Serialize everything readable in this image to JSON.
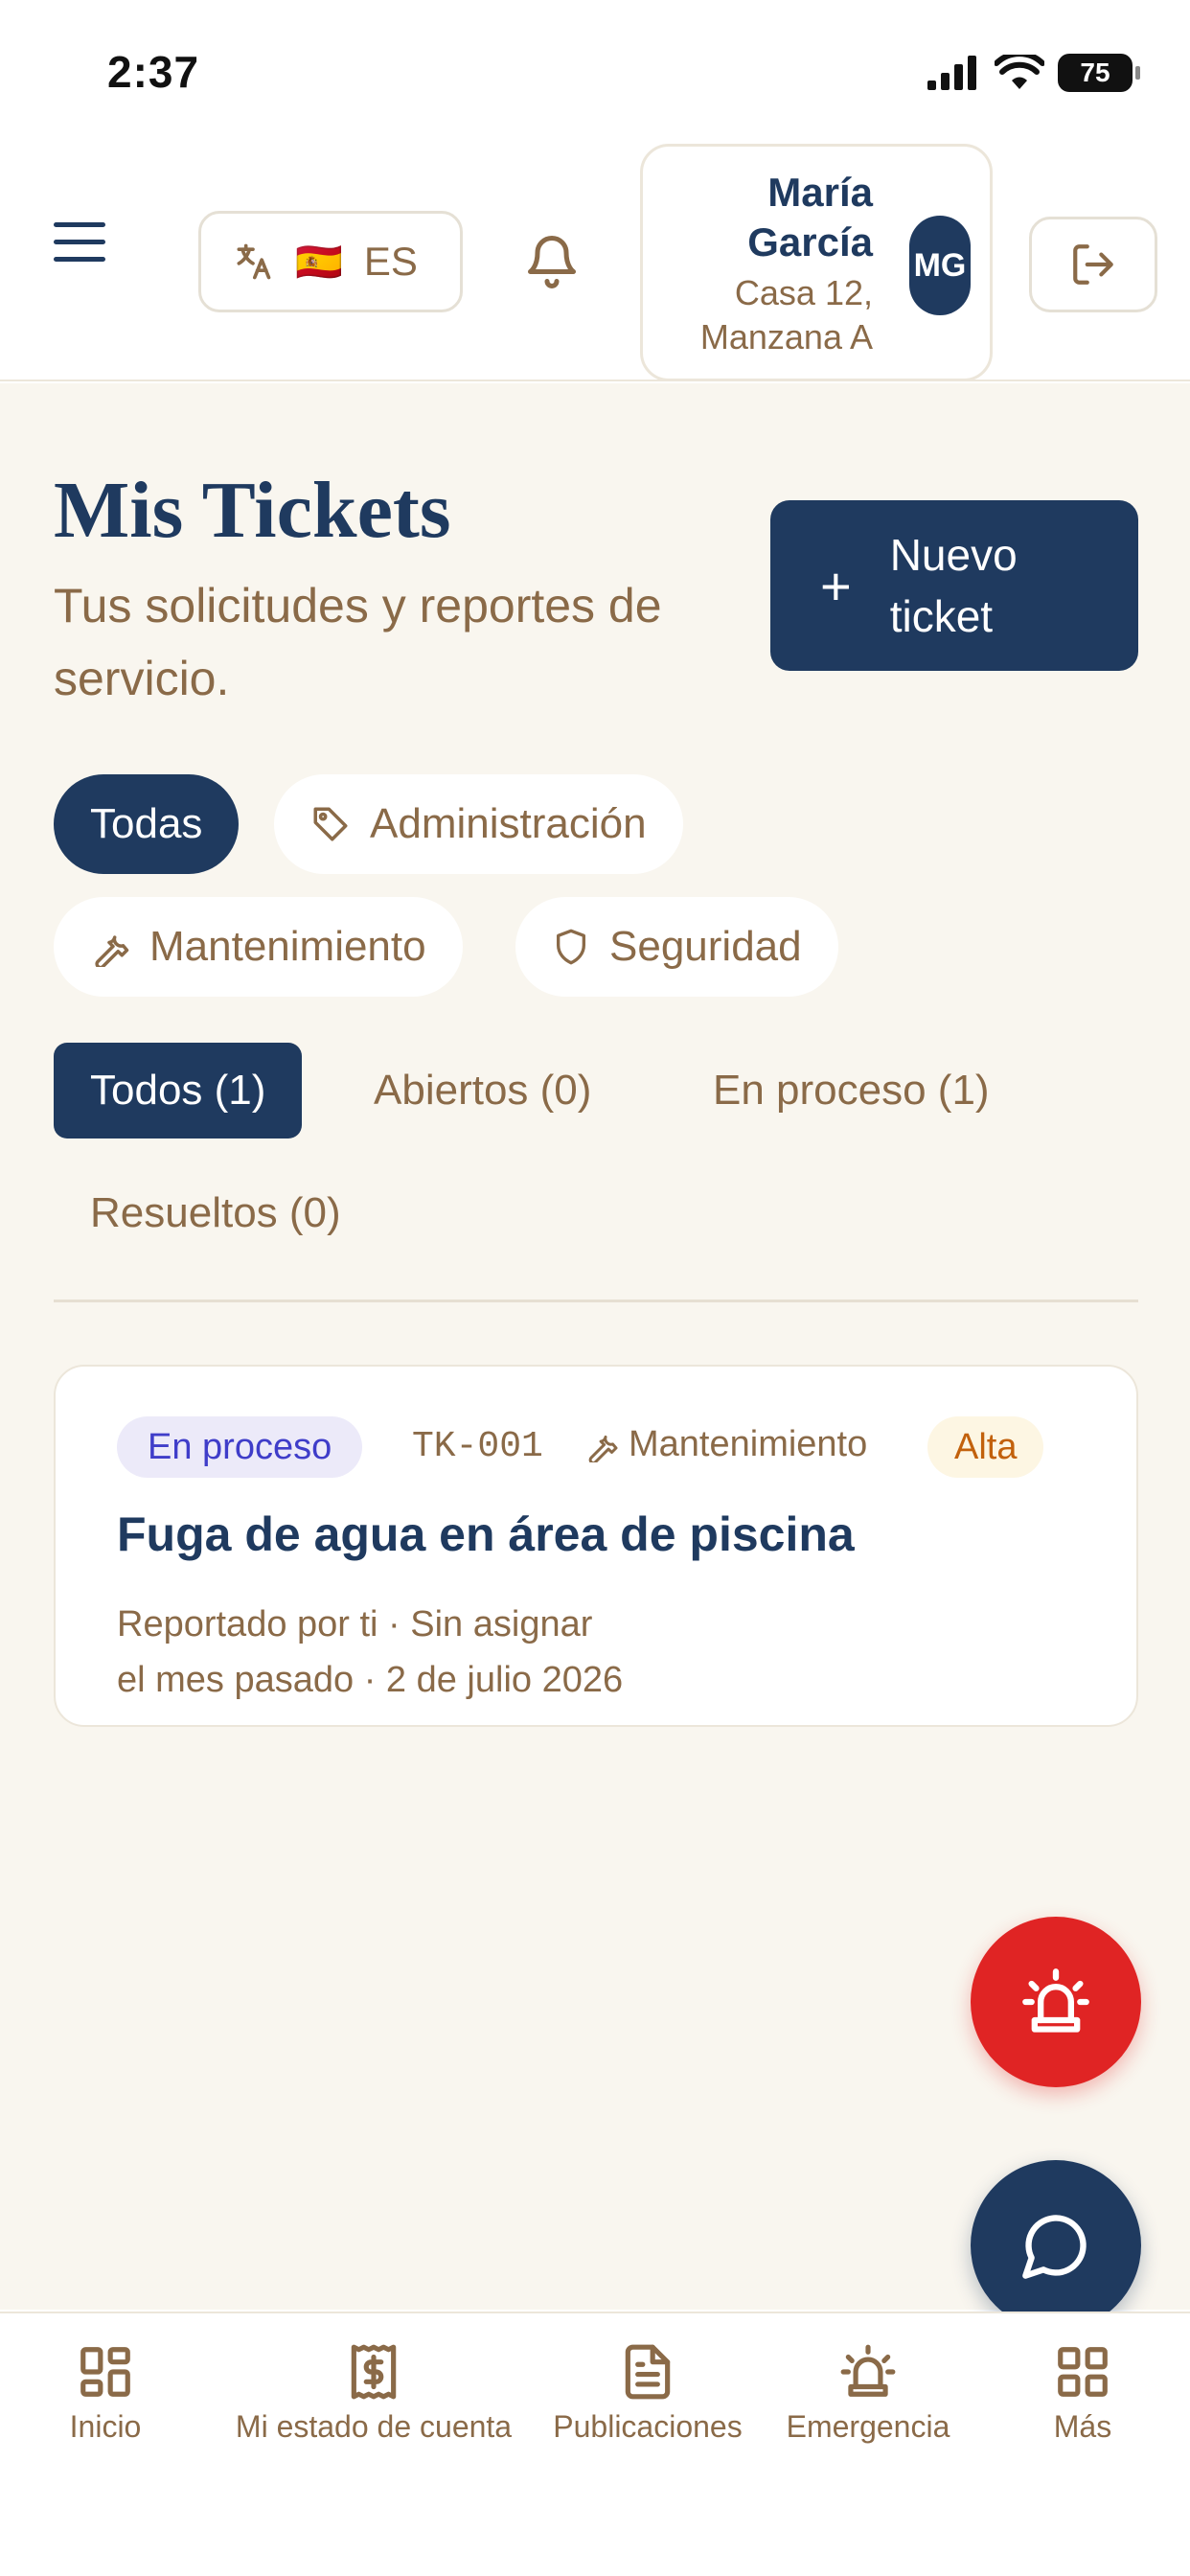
{
  "status_bar": {
    "time": "2:37",
    "battery": "75"
  },
  "header": {
    "language": {
      "code": "ES",
      "flag": "🇪🇸"
    },
    "user": {
      "name": "María García",
      "address": "Casa 12, Manzana A",
      "initials": "MG"
    }
  },
  "page": {
    "title": "Mis Tickets",
    "subtitle": "Tus solicitudes y reportes de servicio.",
    "new_ticket_label": "Nuevo ticket"
  },
  "category_filters": [
    {
      "label": "Todas",
      "active": true
    },
    {
      "label": "Administración",
      "icon": "tag-icon"
    },
    {
      "label": "Mantenimiento",
      "icon": "wrench-icon"
    },
    {
      "label": "Seguridad",
      "icon": "shield-icon"
    }
  ],
  "status_tabs": [
    {
      "label": "Todos (1)",
      "active": true
    },
    {
      "label": "Abiertos (0)"
    },
    {
      "label": "En proceso (1)"
    },
    {
      "label": "Resueltos (0)"
    }
  ],
  "tickets": [
    {
      "status": "En proceso",
      "id": "TK-001",
      "category": "Mantenimiento",
      "priority": "Alta",
      "title": "Fuga de agua en área de piscina",
      "meta_line1": "Reportado por ti · Sin asignar",
      "meta_line2": "el mes pasado · 2 de julio 2026"
    }
  ],
  "bottom_nav": [
    {
      "label": "Inicio",
      "icon": "grid-icon"
    },
    {
      "label": "Mi estado de cuenta",
      "icon": "receipt-dollar-icon"
    },
    {
      "label": "Publicaciones",
      "icon": "document-icon"
    },
    {
      "label": "Emergencia",
      "icon": "siren-icon"
    },
    {
      "label": "Más",
      "icon": "grid-icon"
    }
  ],
  "colors": {
    "primary": "#1f3a5f",
    "accent_brown": "#8a6a48",
    "emergency": "#e02424",
    "background": "#f9f6ef"
  }
}
